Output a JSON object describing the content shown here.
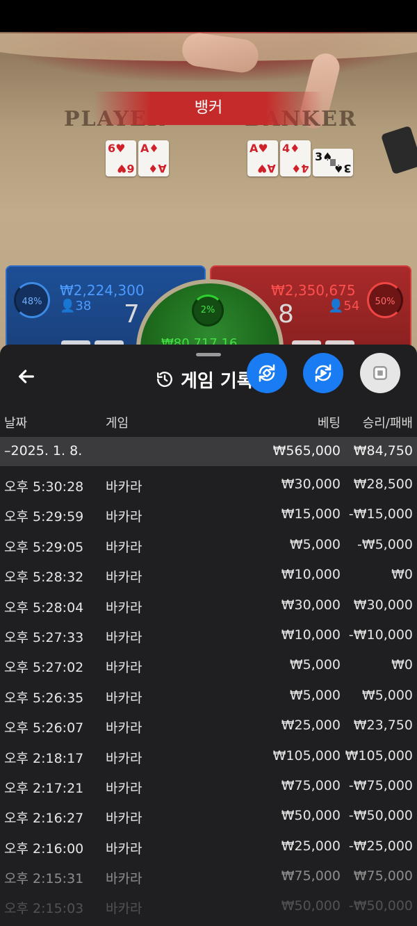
{
  "game": {
    "winner_banner": "뱅커",
    "player_label": "PLAYER",
    "banker_label": "BANKER",
    "player_cards": [
      {
        "rank": "6",
        "suit": "♥",
        "color": "red"
      },
      {
        "rank": "A",
        "suit": "♦",
        "color": "red"
      }
    ],
    "banker_cards": [
      {
        "rank": "A",
        "suit": "♥",
        "color": "red"
      },
      {
        "rank": "4",
        "suit": "♦",
        "color": "red"
      },
      {
        "rank": "3",
        "suit": "♠",
        "color": "black"
      }
    ],
    "player_panel": {
      "percent": "48%",
      "amount": "₩2,224,300",
      "count": "38",
      "score": "7"
    },
    "banker_panel": {
      "percent": "50%",
      "amount": "₩2,350,675",
      "count": "54",
      "score": "8"
    },
    "tie_panel": {
      "percent": "2%",
      "amount": "₩80,717.16"
    },
    "colors": {
      "player": "#1d4f96",
      "banker": "#a92a2a",
      "tie": "#1d6a1d"
    }
  },
  "sheet": {
    "title": "게임 기록",
    "icons": {
      "back": "arrow-left-icon",
      "history": "history-icon",
      "rotate": "rotate-icon",
      "replay": "replay-icon",
      "stop": "stop-icon"
    },
    "colors": {
      "fab_blue": "#1a7cf2",
      "background": "#1f1f21",
      "date_row": "#3b3b3d"
    },
    "columns": {
      "date": "날짜",
      "game": "게임",
      "bet": "베팅",
      "result": "승리/패배"
    },
    "date_group": {
      "date": "–2025. 1. 8.",
      "bet": "₩565,000",
      "result": "₩84,750"
    },
    "rows": [
      {
        "time": "오후 5:30:28",
        "game": "바카라",
        "bet": "₩30,000",
        "result": "₩28,500"
      },
      {
        "time": "오후 5:29:59",
        "game": "바카라",
        "bet": "₩15,000",
        "result": "-₩15,000"
      },
      {
        "time": "오후 5:29:05",
        "game": "바카라",
        "bet": "₩5,000",
        "result": "-₩5,000"
      },
      {
        "time": "오후 5:28:32",
        "game": "바카라",
        "bet": "₩10,000",
        "result": "₩0"
      },
      {
        "time": "오후 5:28:04",
        "game": "바카라",
        "bet": "₩30,000",
        "result": "₩30,000"
      },
      {
        "time": "오후 5:27:33",
        "game": "바카라",
        "bet": "₩10,000",
        "result": "-₩10,000"
      },
      {
        "time": "오후 5:27:02",
        "game": "바카라",
        "bet": "₩5,000",
        "result": "₩0"
      },
      {
        "time": "오후 5:26:35",
        "game": "바카라",
        "bet": "₩5,000",
        "result": "₩5,000"
      },
      {
        "time": "오후 5:26:07",
        "game": "바카라",
        "bet": "₩25,000",
        "result": "₩23,750"
      },
      {
        "time": "오후 2:18:17",
        "game": "바카라",
        "bet": "₩105,000",
        "result": "₩105,000"
      },
      {
        "time": "오후 2:17:21",
        "game": "바카라",
        "bet": "₩75,000",
        "result": "-₩75,000"
      },
      {
        "time": "오후 2:16:27",
        "game": "바카라",
        "bet": "₩50,000",
        "result": "-₩50,000"
      },
      {
        "time": "오후 2:16:00",
        "game": "바카라",
        "bet": "₩25,000",
        "result": "-₩25,000"
      },
      {
        "time": "오후 2:15:31",
        "game": "바카라",
        "bet": "₩75,000",
        "result": "₩75,000"
      },
      {
        "time": "오후 2:15:03",
        "game": "바카라",
        "bet": "₩50,000",
        "result": "-₩50,000"
      }
    ]
  }
}
